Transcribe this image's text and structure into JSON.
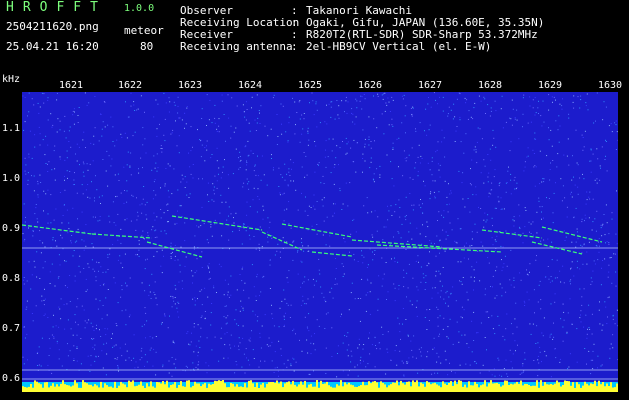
{
  "header": {
    "title": "HROFFT",
    "version": "1.0.0",
    "filename": "2504211620.png",
    "detection_type": "meteor",
    "datetime": "25.04.21 16:20",
    "count": "80"
  },
  "info": [
    {
      "key": "Observer",
      "value": "Takanori Kawachi"
    },
    {
      "key": "Receiving Location",
      "value": "Ogaki, Gifu, JAPAN (136.60E, 35.35N)"
    },
    {
      "key": "Receiver",
      "value": "R820T2(RTL-SDR) SDR-Sharp 53.372MHz"
    },
    {
      "key": "Receiving antenna",
      "value": "2el-HB9CV Vertical (el. E-W)"
    }
  ],
  "axis": {
    "unit": "kHz",
    "y_labels": [
      "1.1",
      "1.0",
      "0.9",
      "0.8",
      "0.7",
      "0.6"
    ],
    "x_labels": [
      "1621",
      "1622",
      "1623",
      "1624",
      "1625",
      "1626",
      "1627",
      "1628",
      "1629",
      "1630"
    ]
  },
  "colors": {
    "background": "#1c1ccc",
    "trace_green": "#39ff7a",
    "trace_yellow": "#ffff33",
    "bottom_cyan": "#00c8ff"
  }
}
